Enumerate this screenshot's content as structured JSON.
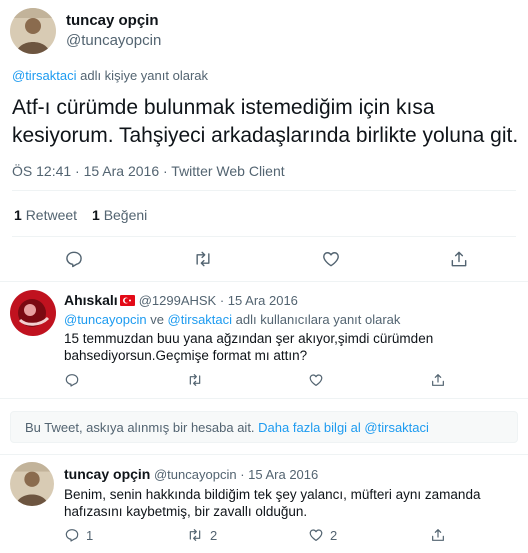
{
  "main_tweet": {
    "author_name": "tuncay opçin",
    "author_handle": "@tuncayopcin",
    "reply_context_handle": "@tirsaktaci",
    "reply_context_suffix": " adlı kişiye yanıt olarak",
    "text_line1": "Atf-ı cürümde bulunmak istemediğim için kısa",
    "text_line2": "kesiyorum. Tahşiyeci arkadaşlarında birlikte yoluna git.",
    "timestamp": "ÖS 12:41 · 15 Ara 2016 · Twitter Web Client",
    "retweet_count": "1",
    "retweet_label": "Retweet",
    "like_count": "1",
    "like_label": "Beğeni"
  },
  "reply1": {
    "author_name": "Ahıskalı",
    "author_handle": "@1299AHSK",
    "date": "· 15 Ara 2016",
    "reply_to_user1": "@tuncayopcin",
    "reply_to_connector": " ve ",
    "reply_to_user2": "@tirsaktaci",
    "reply_to_suffix": " adlı kullanıcılara yanıt olarak",
    "text_line1": "15 temmuzdan buu yana ağzından şer akıyor,şimdi cürümden",
    "text_line2": "bahsediyorsun.Geçmişe format mı attın?"
  },
  "notice": {
    "text": "Bu Tweet, askıya alınmış bir hesaba ait.",
    "learn_more": "Daha fazla bilgi al",
    "handle": "@tirsaktaci"
  },
  "reply2": {
    "author_name": "tuncay opçin",
    "author_handle": "@tuncayopcin",
    "date": "· 15 Ara 2016",
    "text_line1": "Benim, senin hakkında bildiğim tek şey yalancı, müfteri aynı zamanda",
    "text_line2": "hafızasını kaybetmiş, bir zavallı olduğun.",
    "reply_count": "1",
    "retweet_count": "2",
    "like_count": "2"
  },
  "colors": {
    "accent": "#1d9bf0",
    "muted": "#536471",
    "divider": "#eff3f4",
    "flag_red": "#e30a17"
  },
  "icons": [
    "reply-icon",
    "retweet-icon",
    "like-icon",
    "share-icon",
    "flag-icon"
  ]
}
